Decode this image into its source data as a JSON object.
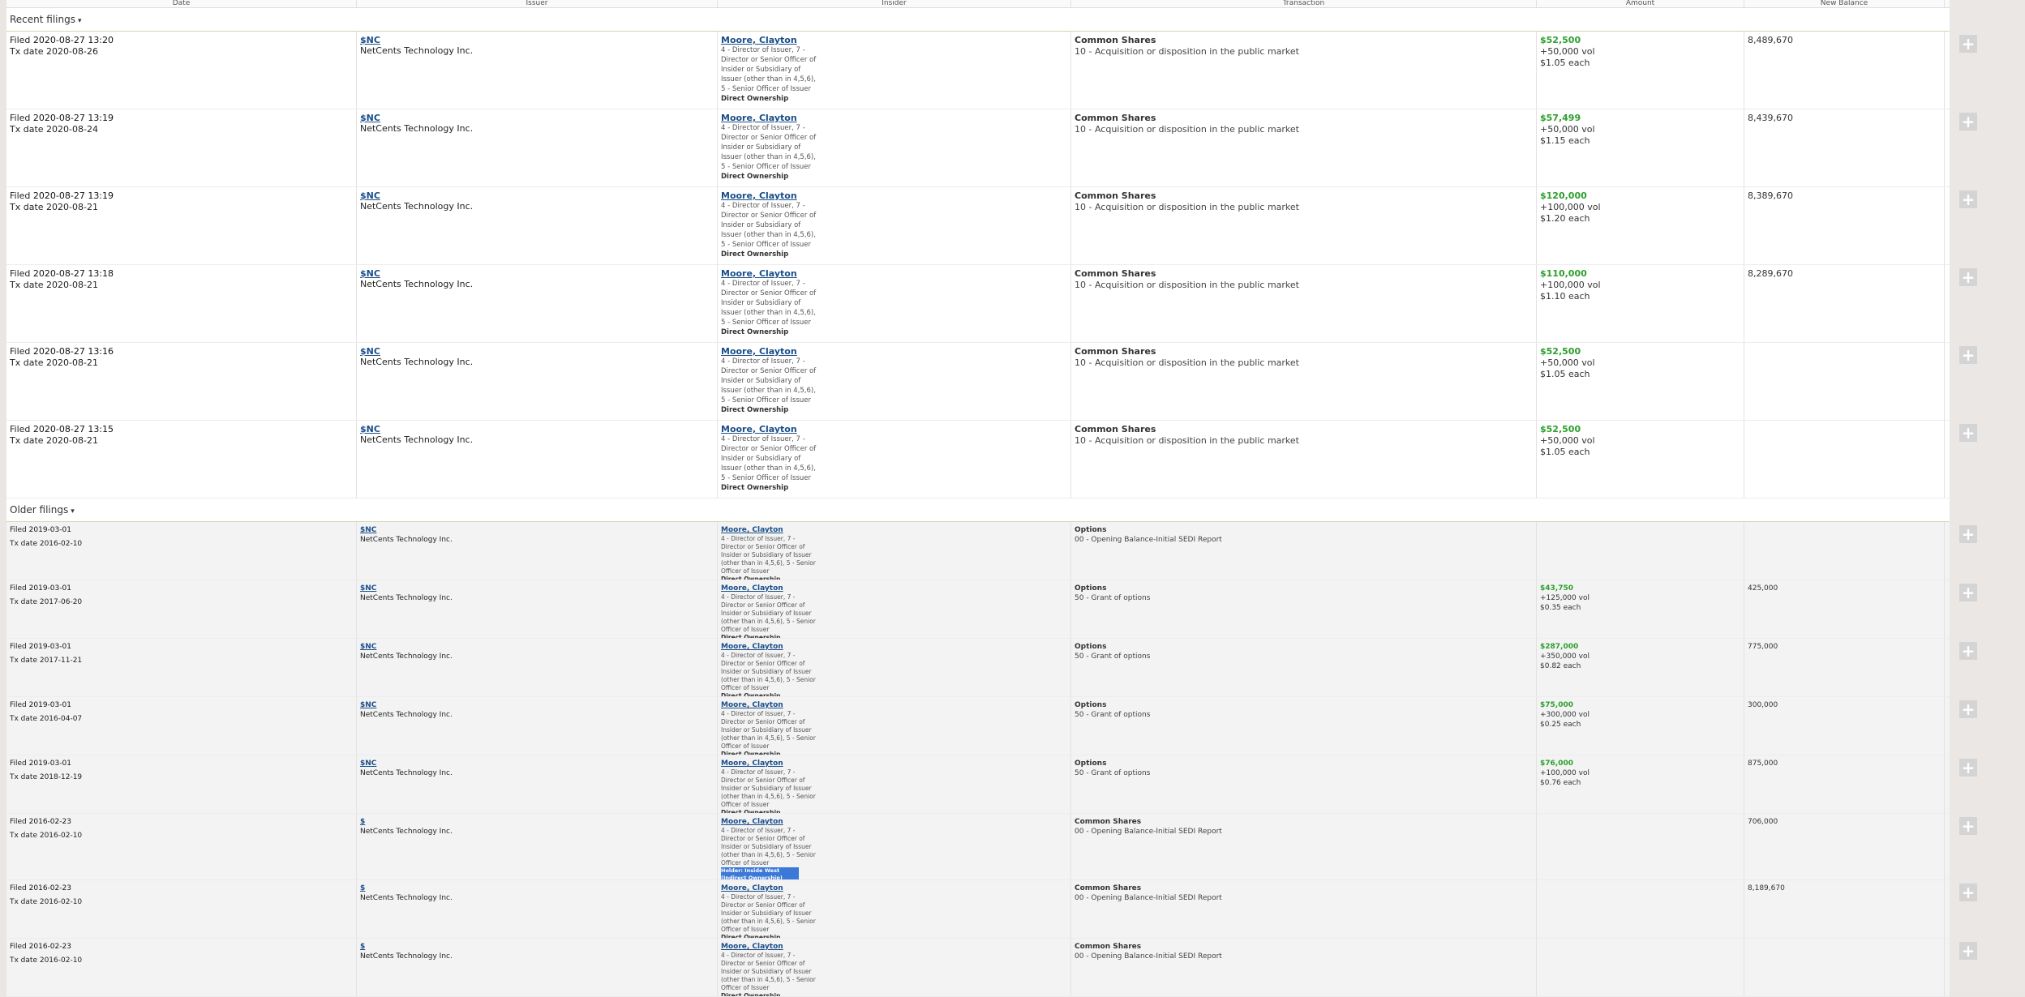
{
  "headers": [
    "Date",
    "Issuer",
    "Insider",
    "Transaction",
    "Amount",
    "New Balance"
  ],
  "sections": {
    "recent": "Recent filings",
    "older": "Older filings"
  },
  "recent": [
    {
      "filed": "2020-08-27 13:20",
      "tx": "2020-08-26",
      "sym": "$NC",
      "company": "NetCents Technology Inc.",
      "insider": "Moore, Clayton",
      "rel": "4 - Director of Issuer, 7 - Director or Senior Officer of Insider or Subsidiary of Issuer (other than in 4,5,6), 5 - Senior Officer of Issuer",
      "own": "Direct Ownership",
      "security": "Common Shares",
      "txtype": "10 - Acquisition or disposition in the public market",
      "amount": "$52,500",
      "vol": "+50,000 vol",
      "each": "$1.05 each",
      "balance": "8,489,670"
    },
    {
      "filed": "2020-08-27 13:19",
      "tx": "2020-08-24",
      "sym": "$NC",
      "company": "NetCents Technology Inc.",
      "insider": "Moore, Clayton",
      "rel": "4 - Director of Issuer, 7 - Director or Senior Officer of Insider or Subsidiary of Issuer (other than in 4,5,6), 5 - Senior Officer of Issuer",
      "own": "Direct Ownership",
      "security": "Common Shares",
      "txtype": "10 - Acquisition or disposition in the public market",
      "amount": "$57,499",
      "vol": "+50,000 vol",
      "each": "$1.15 each",
      "balance": "8,439,670"
    },
    {
      "filed": "2020-08-27 13:19",
      "tx": "2020-08-21",
      "sym": "$NC",
      "company": "NetCents Technology Inc.",
      "insider": "Moore, Clayton",
      "rel": "4 - Director of Issuer, 7 - Director or Senior Officer of Insider or Subsidiary of Issuer (other than in 4,5,6), 5 - Senior Officer of Issuer",
      "own": "Direct Ownership",
      "security": "Common Shares",
      "txtype": "10 - Acquisition or disposition in the public market",
      "amount": "$120,000",
      "vol": "+100,000 vol",
      "each": "$1.20 each",
      "balance": "8,389,670"
    },
    {
      "filed": "2020-08-27 13:18",
      "tx": "2020-08-21",
      "sym": "$NC",
      "company": "NetCents Technology Inc.",
      "insider": "Moore, Clayton",
      "rel": "4 - Director of Issuer, 7 - Director or Senior Officer of Insider or Subsidiary of Issuer (other than in 4,5,6), 5 - Senior Officer of Issuer",
      "own": "Direct Ownership",
      "security": "Common Shares",
      "txtype": "10 - Acquisition or disposition in the public market",
      "amount": "$110,000",
      "vol": "+100,000 vol",
      "each": "$1.10 each",
      "balance": "8,289,670"
    },
    {
      "filed": "2020-08-27 13:16",
      "tx": "2020-08-21",
      "sym": "$NC",
      "company": "NetCents Technology Inc.",
      "insider": "Moore, Clayton",
      "rel": "4 - Director of Issuer, 7 - Director or Senior Officer of Insider or Subsidiary of Issuer (other than in 4,5,6), 5 - Senior Officer of Issuer",
      "own": "Direct Ownership",
      "security": "Common Shares",
      "txtype": "10 - Acquisition or disposition in the public market",
      "amount": "$52,500",
      "vol": "+50,000 vol",
      "each": "$1.05 each",
      "balance": ""
    },
    {
      "filed": "2020-08-27 13:15",
      "tx": "2020-08-21",
      "sym": "$NC",
      "company": "NetCents Technology Inc.",
      "insider": "Moore, Clayton",
      "rel": "4 - Director of Issuer, 7 - Director or Senior Officer of Insider or Subsidiary of Issuer (other than in 4,5,6), 5 - Senior Officer of Issuer",
      "own": "Direct Ownership",
      "security": "Common Shares",
      "txtype": "10 - Acquisition or disposition in the public market",
      "amount": "$52,500",
      "vol": "+50,000 vol",
      "each": "$1.05 each",
      "balance": ""
    }
  ],
  "older": [
    {
      "filed": "2019-03-01",
      "tx": "2016-02-10",
      "sym": "$NC",
      "company": "NetCents Technology Inc.",
      "insider": "Moore, Clayton",
      "rel": "4 - Director of Issuer, 7 - Director or Senior Officer of Insider or Subsidiary of Issuer (other than in 4,5,6), 5 - Senior Officer of Issuer",
      "own": "Direct Ownership",
      "security": "Options",
      "txtype": "00 - Opening Balance-Initial SEDI Report",
      "amount": "",
      "vol": "",
      "each": "",
      "balance": ""
    },
    {
      "filed": "2019-03-01",
      "tx": "2017-06-20",
      "sym": "$NC",
      "company": "NetCents Technology Inc.",
      "insider": "Moore, Clayton",
      "rel": "4 - Director of Issuer, 7 - Director or Senior Officer of Insider or Subsidiary of Issuer (other than in 4,5,6), 5 - Senior Officer of Issuer",
      "own": "Direct Ownership",
      "security": "Options",
      "txtype": "50 - Grant of options",
      "amount": "$43,750",
      "vol": "+125,000 vol",
      "each": "$0.35 each",
      "balance": "425,000"
    },
    {
      "filed": "2019-03-01",
      "tx": "2017-11-21",
      "sym": "$NC",
      "company": "NetCents Technology Inc.",
      "insider": "Moore, Clayton",
      "rel": "4 - Director of Issuer, 7 - Director or Senior Officer of Insider or Subsidiary of Issuer (other than in 4,5,6), 5 - Senior Officer of Issuer",
      "own": "Direct Ownership",
      "security": "Options",
      "txtype": "50 - Grant of options",
      "amount": "$287,000",
      "vol": "+350,000 vol",
      "each": "$0.82 each",
      "balance": "775,000"
    },
    {
      "filed": "2019-03-01",
      "tx": "2016-04-07",
      "sym": "$NC",
      "company": "NetCents Technology Inc.",
      "insider": "Moore, Clayton",
      "rel": "4 - Director of Issuer, 7 - Director or Senior Officer of Insider or Subsidiary of Issuer (other than in 4,5,6), 5 - Senior Officer of Issuer",
      "own": "Direct Ownership",
      "security": "Options",
      "txtype": "50 - Grant of options",
      "amount": "$75,000",
      "vol": "+300,000 vol",
      "each": "$0.25 each",
      "balance": "300,000"
    },
    {
      "filed": "2019-03-01",
      "tx": "2018-12-19",
      "sym": "$NC",
      "company": "NetCents Technology Inc.",
      "insider": "Moore, Clayton",
      "rel": "4 - Director of Issuer, 7 - Director or Senior Officer of Insider or Subsidiary of Issuer (other than in 4,5,6), 5 - Senior Officer of Issuer",
      "own": "Direct Ownership",
      "security": "Options",
      "txtype": "50 - Grant of options",
      "amount": "$76,000",
      "vol": "+100,000 vol",
      "each": "$0.76 each",
      "balance": "875,000"
    },
    {
      "filed": "2016-02-23",
      "tx": "2016-02-10",
      "sym": "$",
      "company": "NetCents Technology Inc.",
      "insider": "Moore, Clayton",
      "rel": "4 - Director of Issuer, 7 - Director or Senior Officer of Insider or Subsidiary of Issuer (other than in 4,5,6), 5 - Senior Officer of Issuer",
      "own": "Holder: Inside West (Indirect Ownership)",
      "security": "Common Shares",
      "txtype": "00 - Opening Balance-Initial SEDI Report",
      "amount": "",
      "vol": "",
      "each": "",
      "balance": "706,000"
    },
    {
      "filed": "2016-02-23",
      "tx": "2016-02-10",
      "sym": "$",
      "company": "NetCents Technology Inc.",
      "insider": "Moore, Clayton",
      "rel": "4 - Director of Issuer, 7 - Director or Senior Officer of Insider or Subsidiary of Issuer (other than in 4,5,6), 5 - Senior Officer of Issuer",
      "own": "Direct Ownership",
      "security": "Common Shares",
      "txtype": "00 - Opening Balance-Initial SEDI Report",
      "amount": "",
      "vol": "",
      "each": "",
      "balance": "8,189,670"
    },
    {
      "filed": "2016-02-23",
      "tx": "2016-02-10",
      "sym": "$",
      "company": "NetCents Technology Inc.",
      "insider": "Moore, Clayton",
      "rel": "4 - Director of Issuer, 7 - Director or Senior Officer of Insider or Subsidiary of Issuer (other than in 4,5,6), 5 - Senior Officer of Issuer",
      "own": "Direct Ownership",
      "security": "Common Shares",
      "txtype": "00 - Opening Balance-Initial SEDI Report",
      "amount": "",
      "vol": "",
      "each": "",
      "balance": ""
    }
  ],
  "labels": {
    "filed": "Filed",
    "tx": "Tx date",
    "plus": "+"
  }
}
